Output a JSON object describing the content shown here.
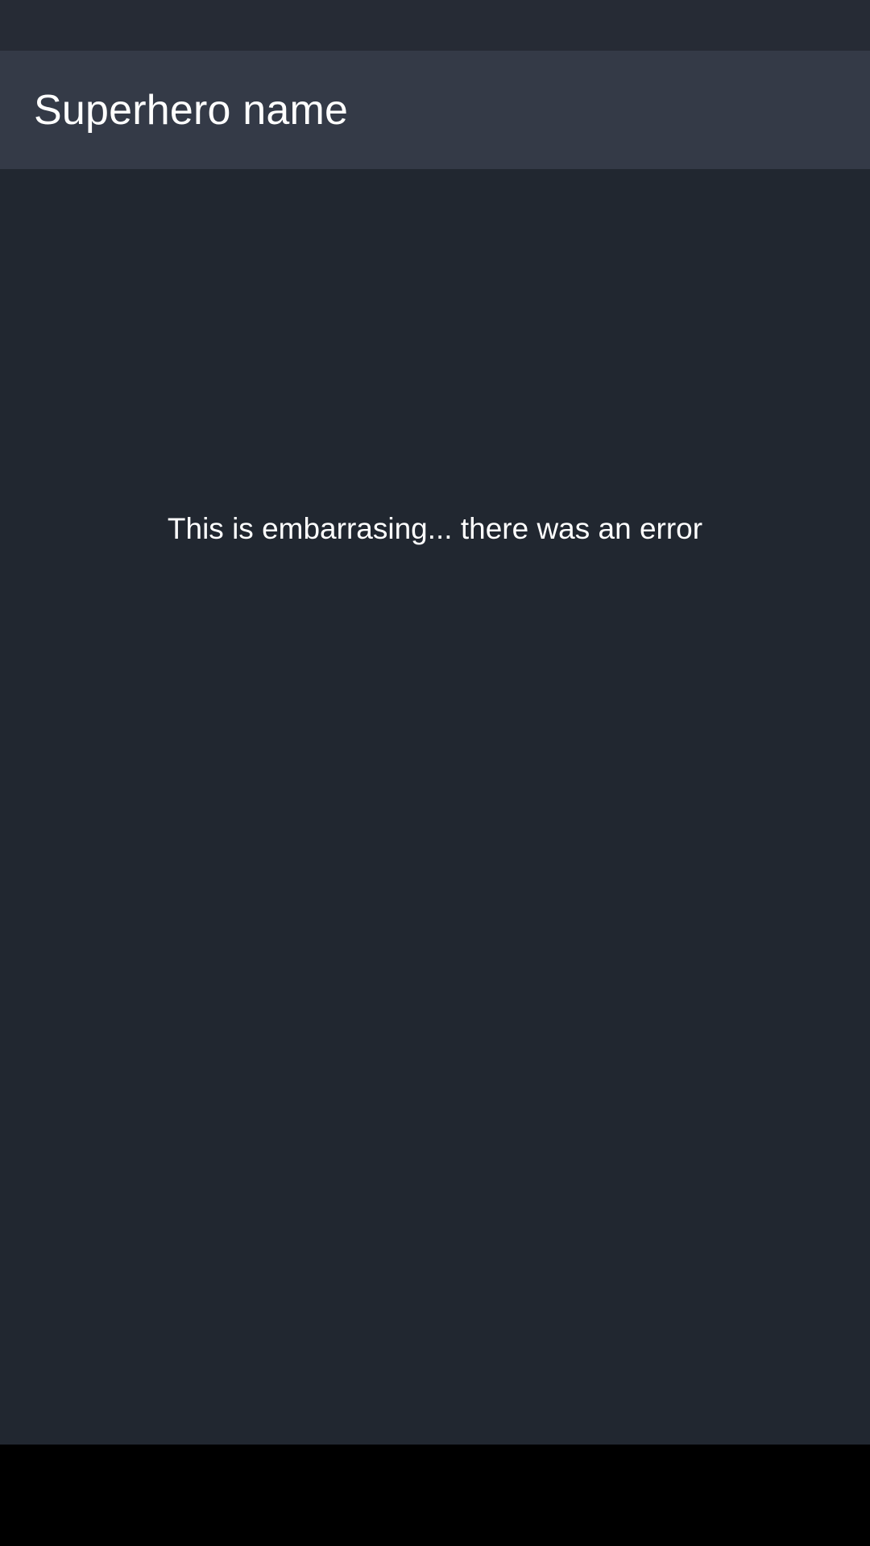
{
  "app_bar": {
    "title": "Superhero name"
  },
  "main": {
    "error_message": "This is embarrasing... there was an error"
  },
  "colors": {
    "status_bar": "#262b35",
    "app_bar": "#343a47",
    "content_background": "#212730",
    "text": "#ffffff",
    "nav_bar": "#000000"
  }
}
